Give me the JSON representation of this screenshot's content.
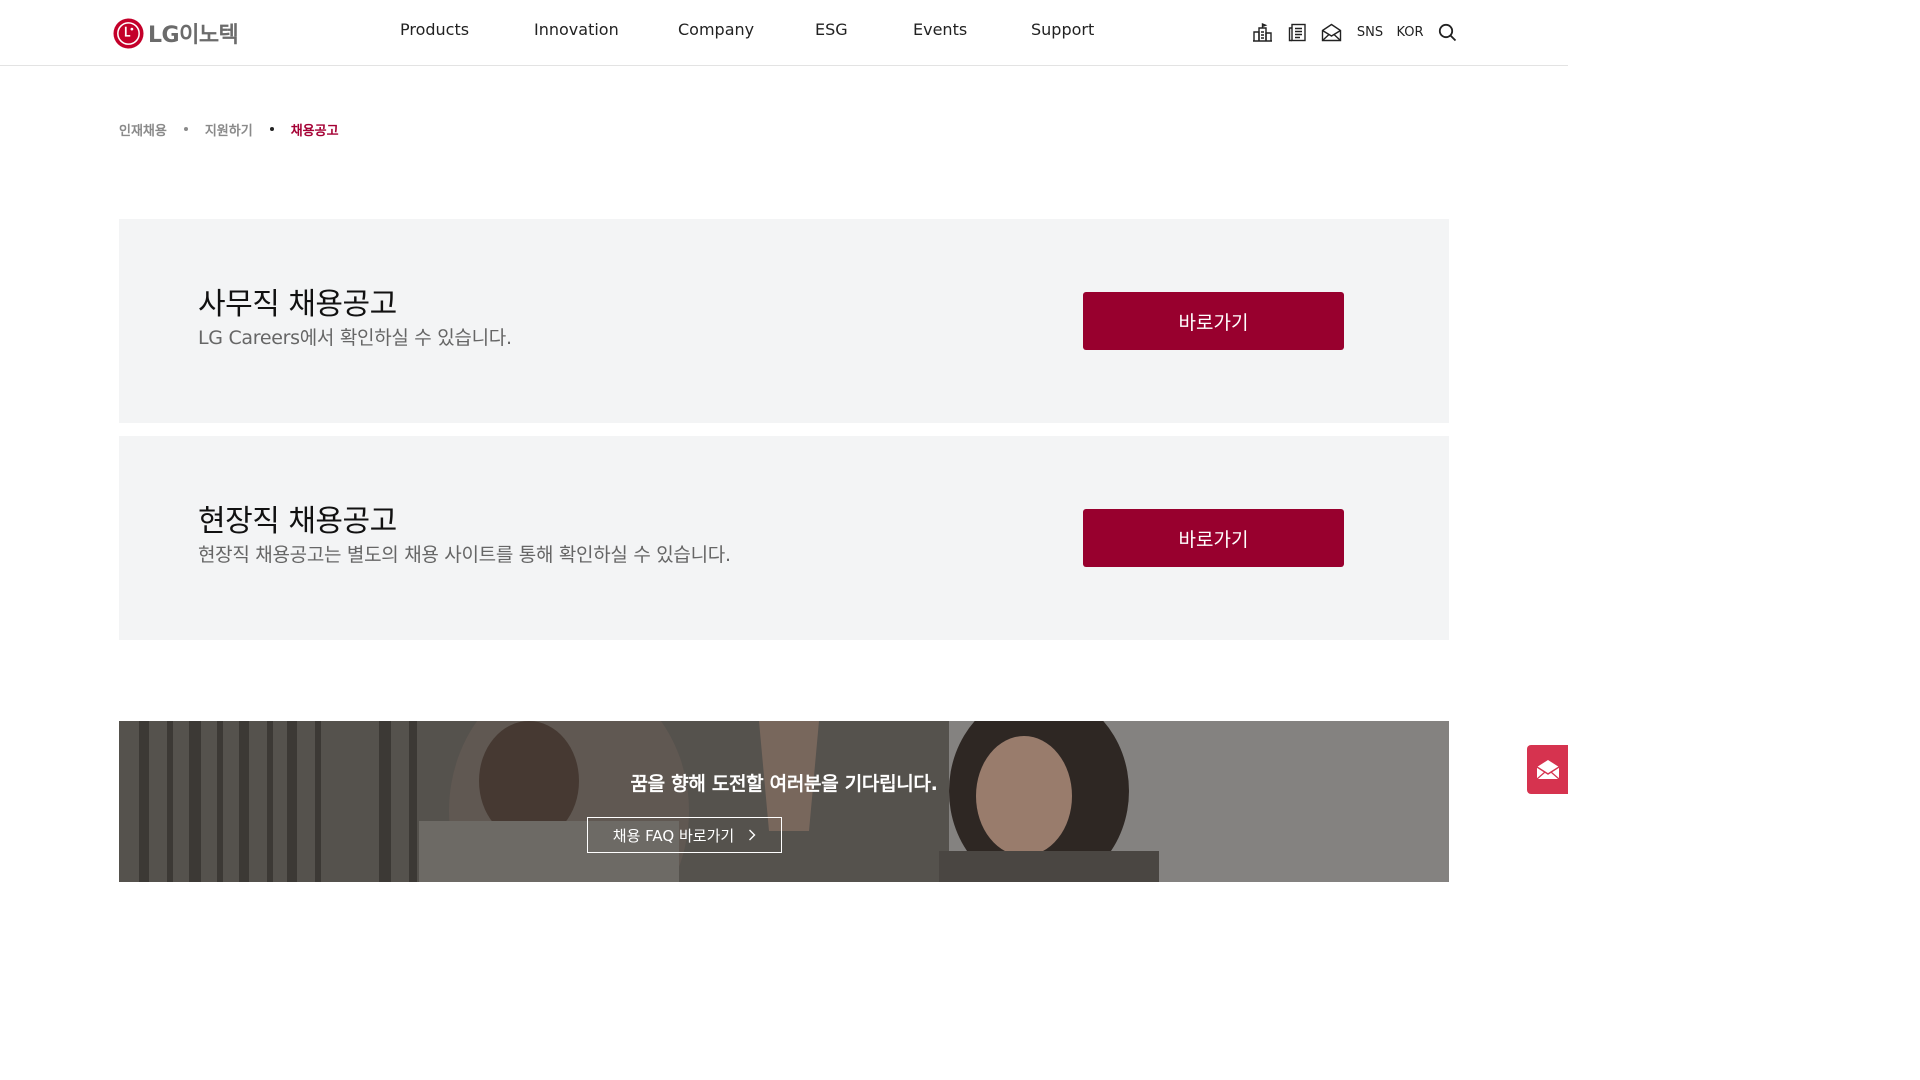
{
  "header": {
    "logo_text": "LG이노텍",
    "nav": [
      {
        "label": "Products"
      },
      {
        "label": "Innovation"
      },
      {
        "label": "Company"
      },
      {
        "label": "ESG"
      },
      {
        "label": "Events"
      },
      {
        "label": "Support"
      }
    ],
    "utils": {
      "icons": [
        "ir-building-icon",
        "newsletter-icon",
        "mail-icon"
      ],
      "sns_label": "SNS",
      "lang_label": "KOR",
      "search_icon": "search-icon"
    }
  },
  "breadcrumb": [
    {
      "label": "인재채용"
    },
    {
      "label": "지원하기"
    },
    {
      "label": "채용공고"
    }
  ],
  "cards": [
    {
      "title": "사무직 채용공고",
      "desc": "LG Careers에서 확인하실 수 있습니다.",
      "button": "바로가기"
    },
    {
      "title": "현장직 채용공고",
      "desc": "현장직 채용공고는 별도의 채용 사이트를 통해 확인하실 수 있습니다.",
      "button": "바로가기"
    }
  ],
  "banner": {
    "title": "꿈을 향해 도전할 여러분을 기다립니다.",
    "faq_button": "채용 FAQ 바로가기"
  },
  "colors": {
    "brand": "#a50034",
    "button": "#98002e",
    "card_bg": "#f3f4f5",
    "float_mail": "#d6334f"
  }
}
